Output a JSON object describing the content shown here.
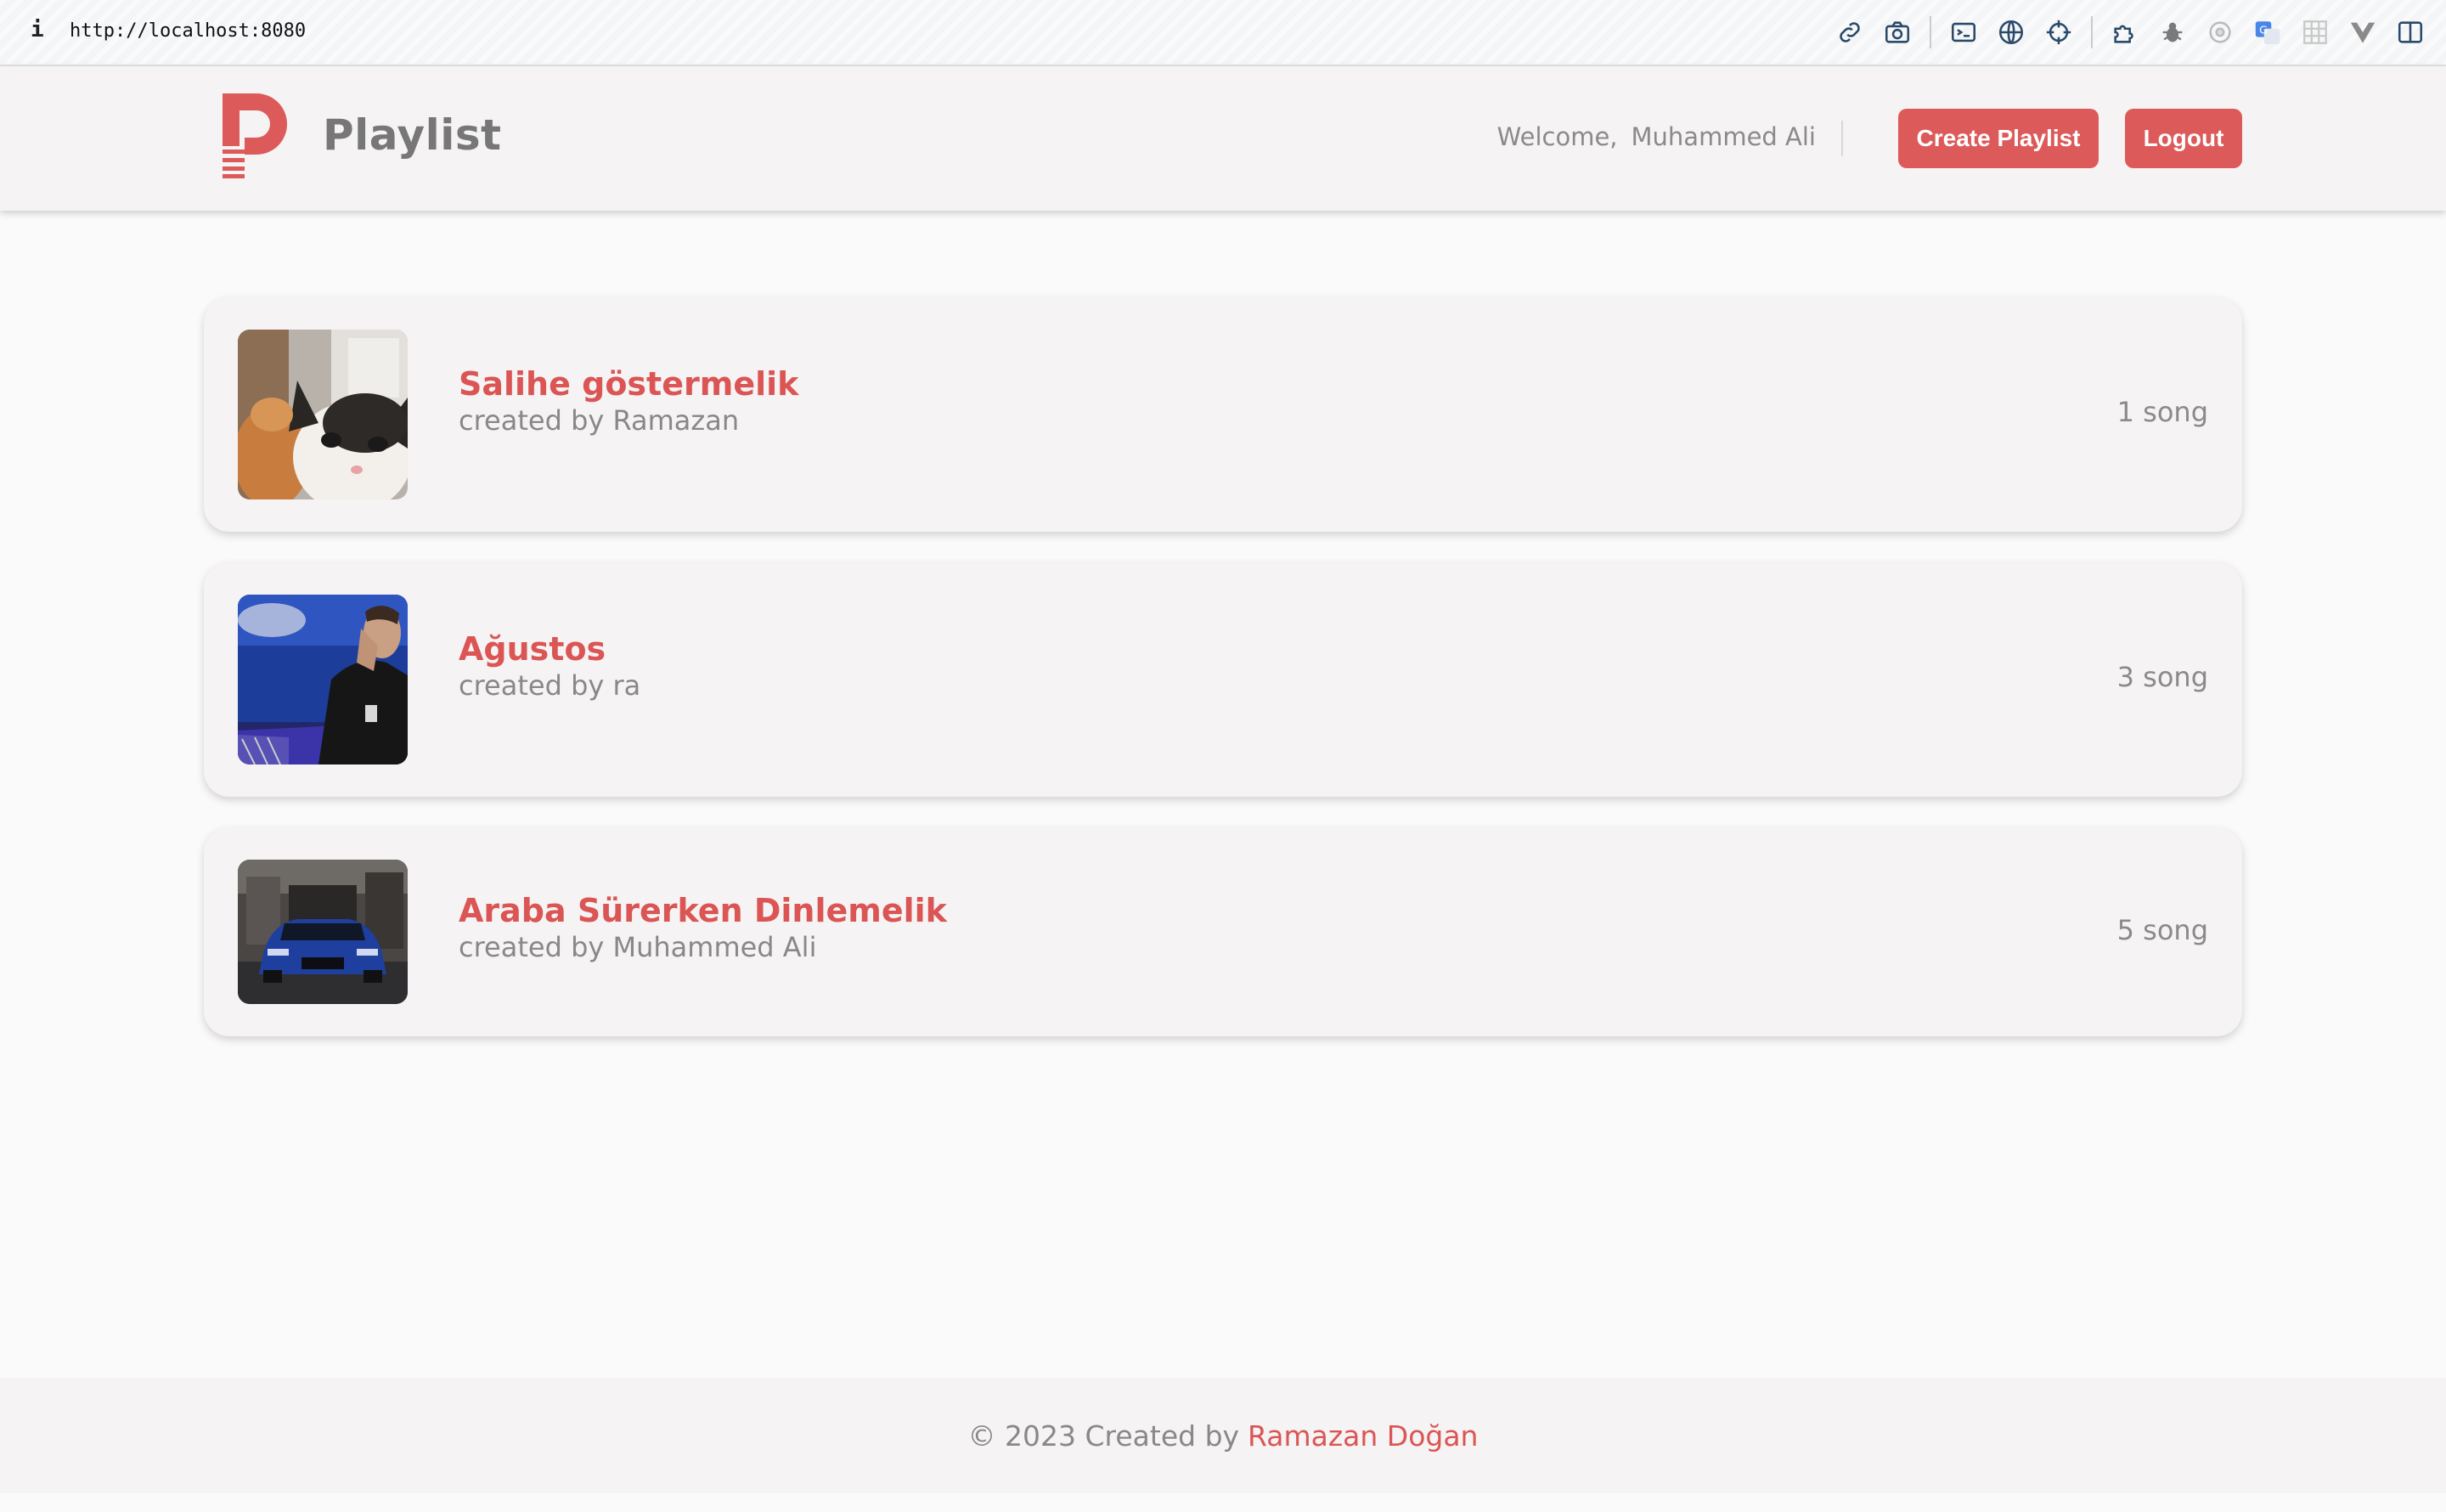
{
  "browser": {
    "info": "i",
    "url": "http://localhost:8080",
    "tools": [
      "link-icon",
      "camera-icon",
      "terminal-icon",
      "globe-icon",
      "crosshair-icon",
      "puzzle-icon",
      "bug-icon",
      "circle-icon",
      "translate-icon",
      "grid-icon",
      "vue-icon",
      "sidebar-icon"
    ]
  },
  "header": {
    "brand": "Playlist",
    "welcome": "Welcome,",
    "user": "Muhammed Ali",
    "create_label": "Create Playlist",
    "logout_label": "Logout"
  },
  "playlists": [
    {
      "title": "Salihe göstermelik",
      "creator": "created by Ramazan",
      "count": "1 song",
      "image": "cat-photo"
    },
    {
      "title": "Ağustos",
      "creator": "created by ra",
      "count": "3 song",
      "image": "referee-photo"
    },
    {
      "title": "Araba Sürerken Dinlemelik",
      "creator": "created by Muhammed Ali",
      "count": "5 song",
      "image": "car-photo"
    }
  ],
  "footer": {
    "copyright": "© 2023 Created by",
    "author": "Ramazan Doğan"
  },
  "colors": {
    "accent": "#dd5a5a",
    "text_muted": "#888888",
    "surface": "#f5f3f3"
  }
}
